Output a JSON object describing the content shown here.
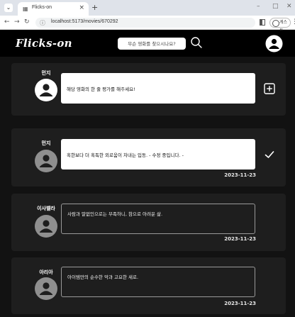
{
  "browser": {
    "tab_title": "Flicks-on",
    "tab_close": "×",
    "new_tab": "+",
    "url": "localhost:5173/movies/670292",
    "profile_label": "게스트",
    "minimize": "–",
    "maximize": "□",
    "close": "✕"
  },
  "header": {
    "logo": "Flicks-on",
    "search_placeholder": "무슨 영화를 찾으시나요?"
  },
  "reviews": [
    {
      "name": "먼지",
      "text": "해당 영화의 한 줄 평가를 해주세요!",
      "date": "",
      "style": "input",
      "action_icon": "plus-square-icon",
      "avatar_color": "#ffffff"
    },
    {
      "name": "먼지",
      "text": "혹한보다 더 혹독한 외로움이 차내는 입동. - 수정 중입니다. -",
      "date": "2023-11-23",
      "style": "editing",
      "action_icon": "check-icon",
      "avatar_color": "#8f8f8f"
    },
    {
      "name": "이사벨라",
      "text": "사람과 말없인으로는 부족하니, 참으로 아려운 삶.",
      "date": "2023-11-23",
      "style": "readonly",
      "action_icon": "",
      "avatar_color": "#8f8f8f"
    },
    {
      "name": "아리아",
      "text": "아이템만의 순수한 악과 고요한 새로.",
      "date": "2023-11-23",
      "style": "readonly",
      "action_icon": "",
      "avatar_color": "#8f8f8f"
    }
  ]
}
